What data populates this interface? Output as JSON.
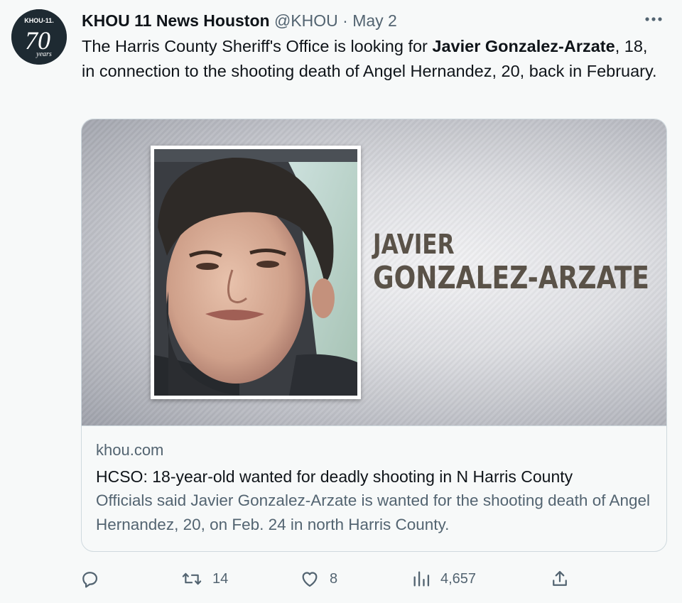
{
  "author": {
    "display_name": "KHOU 11 News Houston",
    "handle": "@KHOU",
    "separator": "·",
    "date": "May 2",
    "avatar_text_top": "KHOU-11.",
    "avatar_text_big": "70",
    "avatar_text_script": "years"
  },
  "tweet": {
    "text_before": "The Harris County Sheriff's Office is looking for ",
    "text_bold": "Javier Gonzalez-Arzate",
    "text_after": ", 18, in connection to the shooting death of Angel Hernandez, 20, back in February."
  },
  "card": {
    "overlay_line1": "JAVIER",
    "overlay_line2": "GONZALEZ-ARZATE",
    "domain": "khou.com",
    "title": "HCSO: 18-year-old wanted for deadly shooting in N Harris County",
    "description": "Officials said Javier Gonzalez-Arzate is wanted for the shooting death of Angel Hernandez, 20, on Feb. 24 in north Harris County."
  },
  "actions": {
    "reply_icon": "reply-icon",
    "retweet_icon": "retweet-icon",
    "retweet_count": "14",
    "like_icon": "heart-icon",
    "like_count": "8",
    "views_icon": "views-icon",
    "views_count": "4,657",
    "share_icon": "share-icon"
  },
  "colors": {
    "text_primary": "#0f1419",
    "text_secondary": "#536471",
    "border": "#cfd9de",
    "background": "#f7f9f9",
    "overlay_text": "#5a5248"
  }
}
